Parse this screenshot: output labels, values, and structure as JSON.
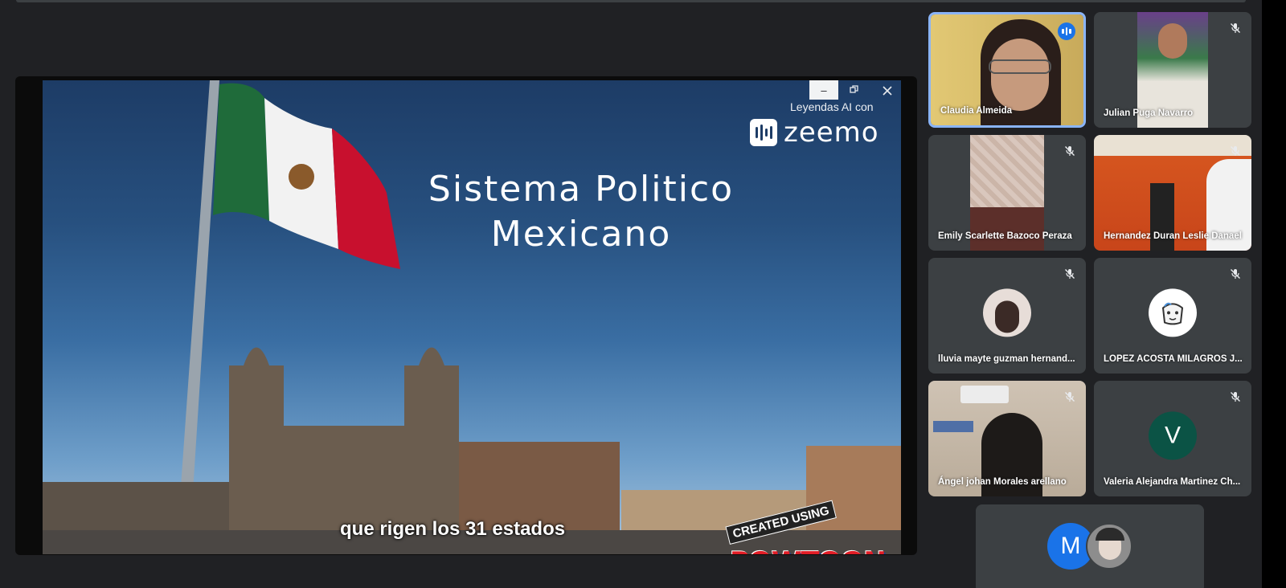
{
  "presentation": {
    "slide": {
      "title_line1": "Sistema Politico",
      "title_line2": "Mexicano",
      "caption": "que rigen los 31 estados",
      "zeemo_credit": "Leyendas AI con",
      "zeemo_brand": "zeemo",
      "powtoon_created": "CREATED USING",
      "powtoon_brand": "POWTOON"
    },
    "controls": {
      "minimize_label": "–",
      "restore_icon": "restore-icon",
      "close_icon": "close-icon"
    }
  },
  "participants": [
    {
      "name": "Claudia Almeida",
      "mic": "speaking",
      "active": true
    },
    {
      "name": "Julian Puga Navarro",
      "mic": "muted"
    },
    {
      "name": "Emily Scarlette Bazoco Peraza",
      "mic": "muted"
    },
    {
      "name": "Hernandez Duran Leslie Danael",
      "mic": "muted"
    },
    {
      "name": "lluvia mayte guzman hernand...",
      "mic": "muted"
    },
    {
      "name": "LOPEZ ACOSTA MILAGROS J...",
      "mic": "muted"
    },
    {
      "name": "Ángel johan Morales arellano",
      "mic": "muted"
    },
    {
      "name": "Valeria Alejandra Martinez Ch...",
      "mic": "muted",
      "avatar_letter": "V",
      "avatar_color": "#0b5345"
    }
  ],
  "others_tile": {
    "avatar_letter": "M",
    "avatar_color": "#1a73e8"
  },
  "colors": {
    "background": "#202124",
    "tile": "#3c4043",
    "active_border": "#8ab4f8",
    "speaking": "#1a73e8"
  }
}
